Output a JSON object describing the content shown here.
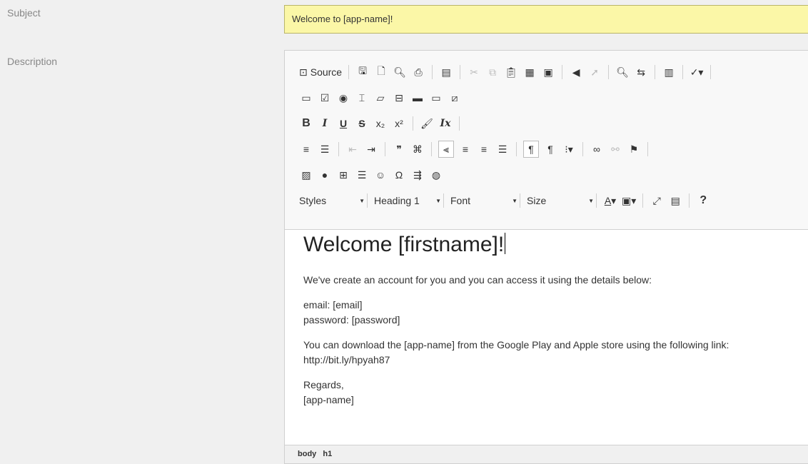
{
  "form": {
    "subject_label": "Subject",
    "subject_value": "Welcome to [app-name]!",
    "description_label": "Description"
  },
  "toolbar": {
    "source_label": "Source",
    "styles_label": "Styles",
    "format_label": "Heading 1",
    "font_label": "Font",
    "size_label": "Size",
    "dropdown_arrow": "▼"
  },
  "content": {
    "heading": "Welcome [firstname]!",
    "intro": "We've create an account for you and you can access it using the details below:",
    "email_line": "email: [email]",
    "password_line": "password: [password]",
    "download_line": "You can download the [app-name] from the Google Play and Apple store using the following link:",
    "link_line": "http://bit.ly/hpyah87",
    "regards": "Regards,",
    "signature": "[app-name]"
  },
  "statusbar": {
    "path": [
      "body",
      "h1"
    ]
  },
  "colors": {
    "subject_bg": "#fbf7a7",
    "toolbar_bg": "#f8f8f8",
    "page_bg": "#f0f0f0"
  }
}
